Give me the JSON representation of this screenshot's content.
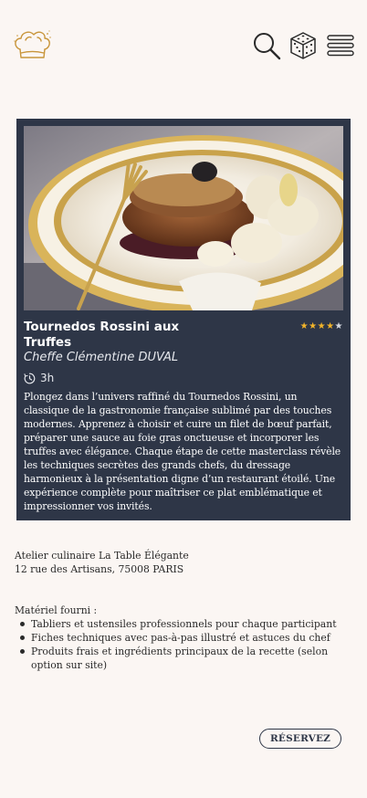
{
  "header": {
    "logo_icon": "chef-hat-icon",
    "search_icon": "search-icon",
    "random_icon": "dice-icon",
    "menu_icon": "hamburger-menu-icon"
  },
  "recipe": {
    "title": "Tournedos Rossini aux Truffes",
    "chef": "Cheffe Clémentine DUVAL",
    "duration": "3h",
    "rating": 4,
    "rating_max": 5,
    "description": "Plongez dans l’univers raffiné du Tournedos Rossini, un classique de la gastronomie française sublimé par des touches modernes. Apprenez à choisir et cuire un filet de bœuf parfait, préparer une sauce au foie gras onctueuse et incorporer les truffes avec élégance. Chaque étape de cette masterclass révèle les techniques secrètes des grands chefs, du dressage harmonieux à la présentation digne d’un restaurant étoilé. Une expérience complète pour maîtriser ce plat emblématique et impressionner vos invités."
  },
  "location": {
    "name": "Atelier culinaire La Table Élégante",
    "address": "12 rue des Artisans, 75008 PARIS"
  },
  "equipment": {
    "title": "Matériel fourni :",
    "items": [
      "Tabliers et ustensiles professionnels pour chaque participant",
      "Fiches techniques avec pas-à-pas illustré et astuces du chef",
      "Produits frais et ingrédients principaux de la recette (selon option sur site)"
    ]
  },
  "actions": {
    "reserve_label": "RÉSERVEZ"
  },
  "colors": {
    "background": "#fbf6f3",
    "card": "#2e3647",
    "accent_gold": "#c8953a",
    "star": "#f2b42a"
  }
}
